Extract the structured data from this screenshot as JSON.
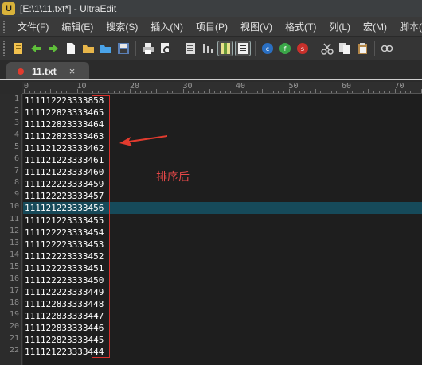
{
  "window": {
    "title": "[E:\\1\\11.txt*] - UltraEdit"
  },
  "menu": [
    "文件(F)",
    "编辑(E)",
    "搜索(S)",
    "插入(N)",
    "项目(P)",
    "视图(V)",
    "格式(T)",
    "列(L)",
    "宏(M)",
    "脚本(i"
  ],
  "toolbar_icons": [
    "new-file-icon",
    "back-icon",
    "forward-icon",
    "new-doc-icon",
    "open-icon",
    "open-folder-icon",
    "save-icon",
    "print-icon",
    "print-preview-icon",
    "document-icon",
    "sort-icon",
    "column-mode-icon",
    "wordwrap-icon",
    "uc-icon",
    "uf-icon",
    "us-icon",
    "cut-icon",
    "copy-icon",
    "paste-icon",
    "find-icon"
  ],
  "tab": {
    "label": "11.txt",
    "close": "×"
  },
  "ruler": {
    "marks": [
      "0",
      "10",
      "20",
      "30",
      "40",
      "50",
      "60",
      "70"
    ]
  },
  "lines": [
    {
      "n": "1",
      "text": "111112223333858"
    },
    {
      "n": "2",
      "text": "111122823333465"
    },
    {
      "n": "3",
      "text": "111122823333464"
    },
    {
      "n": "4",
      "text": "111122823333463"
    },
    {
      "n": "5",
      "text": "111121223333462"
    },
    {
      "n": "6",
      "text": "111121223333461"
    },
    {
      "n": "7",
      "text": "111121223333460"
    },
    {
      "n": "8",
      "text": "111122223333459"
    },
    {
      "n": "9",
      "text": "111122223333457"
    },
    {
      "n": "10",
      "text": "111121223333456"
    },
    {
      "n": "11",
      "text": "111121223333455"
    },
    {
      "n": "12",
      "text": "111122223333454"
    },
    {
      "n": "13",
      "text": "111122223333453"
    },
    {
      "n": "14",
      "text": "111122223333452"
    },
    {
      "n": "15",
      "text": "111122223333451"
    },
    {
      "n": "16",
      "text": "111122223333450"
    },
    {
      "n": "17",
      "text": "111122223333449"
    },
    {
      "n": "18",
      "text": "111122833333448"
    },
    {
      "n": "19",
      "text": "111122833333447"
    },
    {
      "n": "20",
      "text": "111122833333446"
    },
    {
      "n": "21",
      "text": "111122823333445"
    },
    {
      "n": "22",
      "text": "111121223333444"
    }
  ],
  "current_line": 10,
  "annotation": "排序后",
  "colors": {
    "highlight": "#164a5a",
    "box": "#d9302b",
    "annotation": "#e84848"
  }
}
